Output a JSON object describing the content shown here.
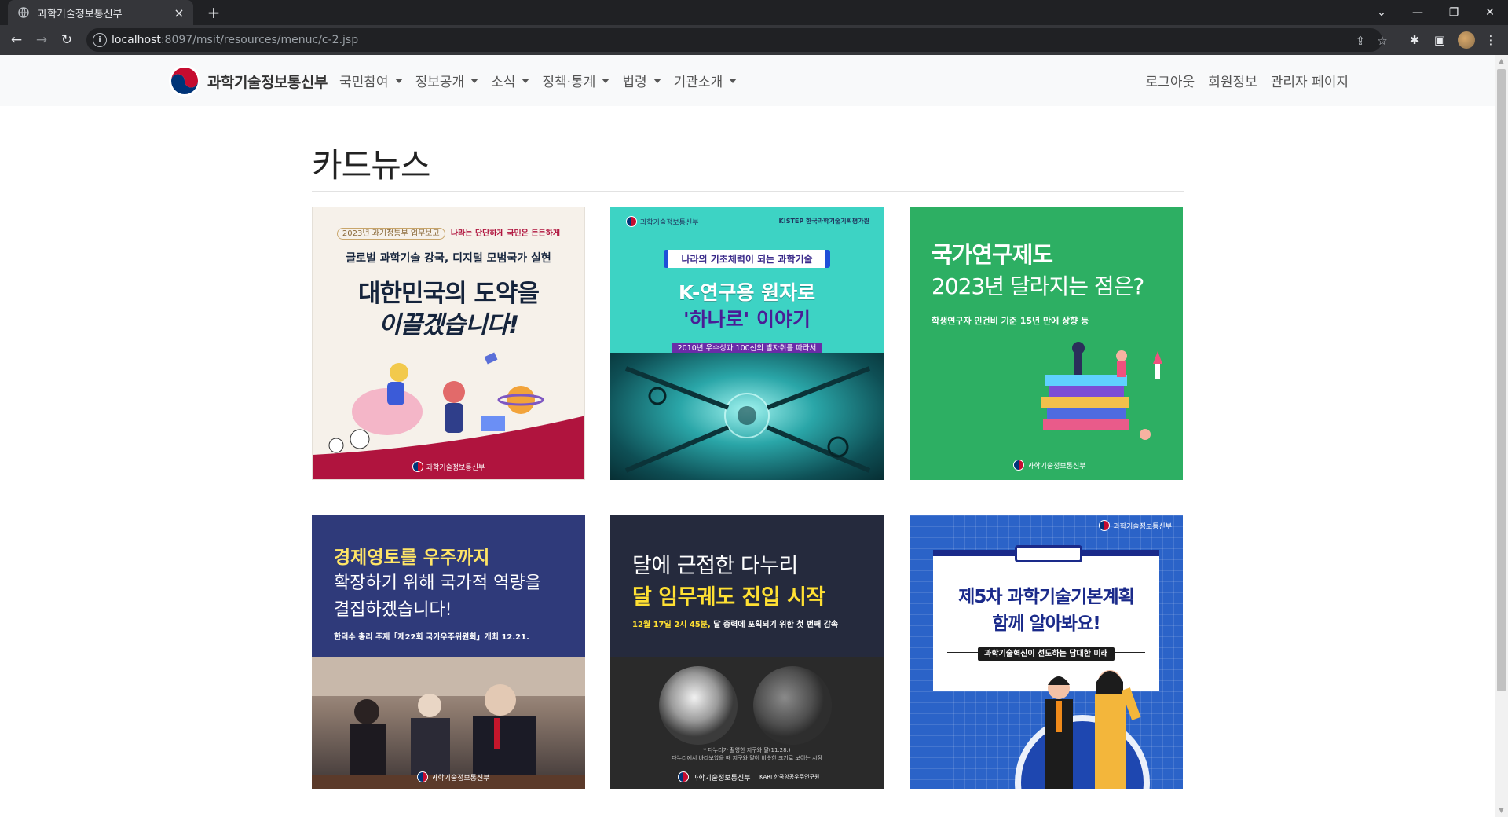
{
  "browser": {
    "tab_title": "과학기술정보통신부",
    "tab_close": "×",
    "new_tab": "+",
    "url_host": "localhost",
    "url_rest": ":8097/msit/resources/menuc/c-2.jsp"
  },
  "site": {
    "brand_name": "과학기술정보통신부",
    "menu": [
      "국민참여",
      "정보공개",
      "소식",
      "정책·통계",
      "법령",
      "기관소개"
    ],
    "right_menu": [
      "로그아웃",
      "회원정보",
      "관리자 페이지"
    ]
  },
  "page": {
    "title": "카드뉴스"
  },
  "cards": [
    {
      "top_tag": "2023년 과기정통부 업무보고",
      "top_slogan": "나라는 단단하게 국민은 든든하게",
      "subtitle": "글로벌 과학기술 강국, 디지털 모범국가 실현",
      "headline1": "대한민국의 도약을",
      "headline2": "이끌겠습니다!",
      "footer": "과학기술정보통신부",
      "colors": {
        "bg": "#f6f1ea",
        "accent": "#b0143e",
        "text": "#15243c"
      }
    },
    {
      "logo_left": "과학기술정보통신부",
      "logo_right": "KISTEP 한국과학기술기획평가원",
      "ribbon": "나라의 기초체력이 되는 과학기술",
      "headline1": "K-연구용 원자로",
      "headline2": "'하나로' 이야기",
      "caption": "2010년 우수성과 100선의 발자취를 따라서",
      "colors": {
        "bg": "#3dd3c4",
        "accent": "#6a2ca8",
        "text": "#ffffff"
      }
    },
    {
      "headline1": "국가연구제도",
      "headline2": "2023년 달라지는 점은?",
      "subtitle": "학생연구자 인건비 기준 15년 만에 상향 등",
      "footer": "과학기술정보통신부",
      "colors": {
        "bg": "#2daf63",
        "text": "#ffffff"
      }
    },
    {
      "headline1": "경제영토를 우주까지",
      "headline2": "확장하기 위해 국가적 역량을",
      "headline3": "결집하겠습니다!",
      "caption": "한덕수 총리 주재「제22회 국가우주위원회」개최  12.21.",
      "footer": "과학기술정보통신부",
      "colors": {
        "bg": "#2f3a7a",
        "highlight": "#ffe566",
        "text": "#ffffff"
      }
    },
    {
      "headline1": "달에 근접한 다누리",
      "headline2": "달 임무궤도 진입 시작",
      "subtitle_hl": "12월 17일 2시 45분,",
      "subtitle": " 달 중력에 포획되기 위한 첫 번째 감속",
      "note1": "* 다누리가 촬영한 지구와 달(11.28.)",
      "note2": "다누리에서 바라보았을 때 지구와 달이 비슷한 크기로 보이는 시점",
      "footer_left": "과학기술정보통신부",
      "footer_right": "KARI 한국항공우주연구원",
      "colors": {
        "bg": "#252a3d",
        "highlight": "#ffe033",
        "text": "#ffffff"
      }
    },
    {
      "logo": "과학기술정보통신부",
      "headline1": "제5차 과학기술기본계획",
      "headline2": "함께 알아봐요!",
      "caption": "과학기술혁신이 선도하는 담대한 미래",
      "colors": {
        "bg": "#2b63c8",
        "text": "#1a2a8a"
      }
    }
  ]
}
